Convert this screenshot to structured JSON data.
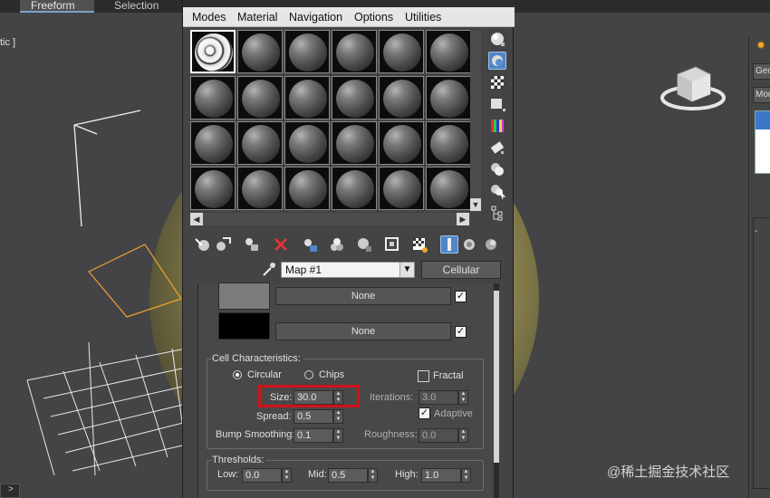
{
  "ribbon": {
    "tabs": [
      "Freeform",
      "Selection"
    ]
  },
  "viewport": {
    "label": "tic ]"
  },
  "command_panel": {
    "dropdown1": "Geo",
    "dropdown2": "Mod",
    "expander": "-"
  },
  "status": {
    "play": ">"
  },
  "watermark": "@稀土掘金技术社区",
  "material_editor": {
    "menu": [
      "Modes",
      "Material",
      "Navigation",
      "Options",
      "Utilities"
    ],
    "name_field": "Map #1",
    "type_button": "Cellular",
    "color_rows": [
      {
        "swatch_color": "#7c7c7c",
        "map_label": "None",
        "checked": true
      },
      {
        "swatch_color": "#000000",
        "map_label": "None",
        "checked": true
      }
    ],
    "cell_characteristics": {
      "title": "Cell Characteristics:",
      "circular_label": "Circular",
      "chips_label": "Chips",
      "selected_type": "Circular",
      "fractal_label": "Fractal",
      "fractal_checked": false,
      "size_label": "Size:",
      "size_value": "30.0",
      "spread_label": "Spread:",
      "spread_value": "0.5",
      "bump_label": "Bump Smoothing:",
      "bump_value": "0.1",
      "iterations_label": "Iterations:",
      "iterations_value": "3.0",
      "adaptive_label": "Adaptive",
      "adaptive_checked": true,
      "roughness_label": "Roughness:",
      "roughness_value": "0.0"
    },
    "thresholds": {
      "title": "Thresholds:",
      "low_label": "Low:",
      "low_value": "0.0",
      "mid_label": "Mid:",
      "mid_value": "0.5",
      "high_label": "High:",
      "high_value": "1.0"
    }
  },
  "colors": {
    "highlight": "#d0121a",
    "selection_blue": "#4f86c7",
    "viewport_bg": "#444447"
  }
}
